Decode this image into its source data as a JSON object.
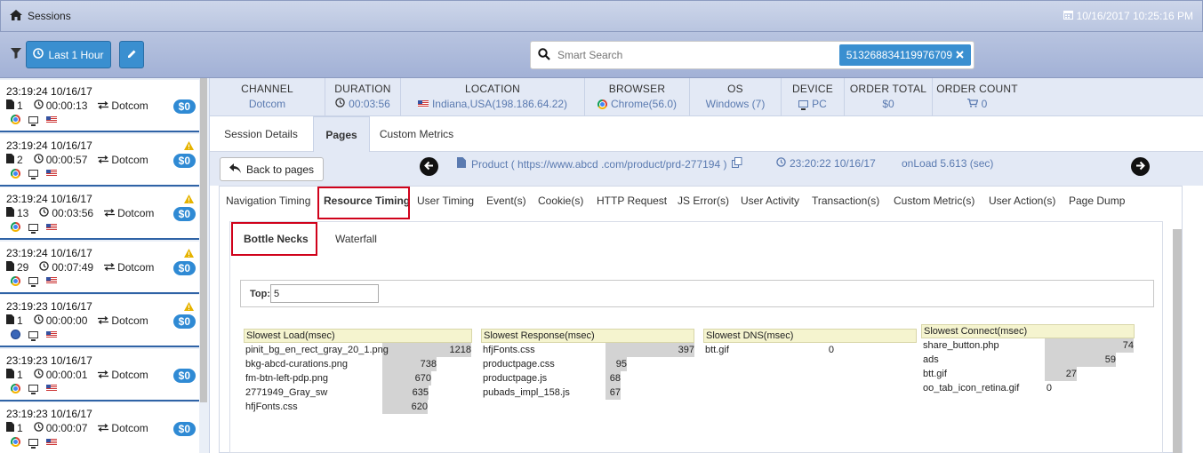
{
  "titlebar": {
    "title": "Sessions",
    "datetime": "10/16/2017 10:25:16 PM"
  },
  "toolbar": {
    "time_filter_label": "Last 1 Hour",
    "search_placeholder": "Smart Search",
    "search_tag": "513268834119976709"
  },
  "sessions": [
    {
      "time": "23:19:24 10/16/17",
      "pages": "1",
      "duration": "00:00:13",
      "channel": "Dotcom",
      "amount": "$0",
      "warning": false,
      "browser": "chrome"
    },
    {
      "time": "23:19:24 10/16/17",
      "pages": "2",
      "duration": "00:00:57",
      "channel": "Dotcom",
      "amount": "$0",
      "warning": true,
      "browser": "chrome"
    },
    {
      "time": "23:19:24 10/16/17",
      "pages": "13",
      "duration": "00:03:56",
      "channel": "Dotcom",
      "amount": "$0",
      "warning": true,
      "browser": "chrome"
    },
    {
      "time": "23:19:24 10/16/17",
      "pages": "29",
      "duration": "00:07:49",
      "channel": "Dotcom",
      "amount": "$0",
      "warning": true,
      "browser": "chrome"
    },
    {
      "time": "23:19:23 10/16/17",
      "pages": "1",
      "duration": "00:00:00",
      "channel": "Dotcom",
      "amount": "$0",
      "warning": true,
      "browser": "globe"
    },
    {
      "time": "23:19:23 10/16/17",
      "pages": "1",
      "duration": "00:00:01",
      "channel": "Dotcom",
      "amount": "$0",
      "warning": false,
      "browser": "chrome"
    },
    {
      "time": "23:19:23 10/16/17",
      "pages": "1",
      "duration": "00:00:07",
      "channel": "Dotcom",
      "amount": "$0",
      "warning": false,
      "browser": "chrome"
    }
  ],
  "summary": {
    "channel": {
      "label": "CHANNEL",
      "value": "Dotcom"
    },
    "duration": {
      "label": "DURATION",
      "value": "00:03:56"
    },
    "location": {
      "label": "LOCATION",
      "value": "Indiana,USA(198.186.64.22)"
    },
    "browser": {
      "label": "BROWSER",
      "value": "Chrome(56.0)"
    },
    "os": {
      "label": "OS",
      "value": "Windows (7)"
    },
    "device": {
      "label": "DEVICE",
      "value": "PC"
    },
    "order_total": {
      "label": "ORDER TOTAL",
      "value": "$0"
    },
    "order_count": {
      "label": "ORDER COUNT",
      "value": "0"
    }
  },
  "main_tabs": [
    "Session Details",
    "Pages",
    "Custom Metrics"
  ],
  "page_bar": {
    "back_label": "Back to pages",
    "page": "Product ( https://www.abcd .com/product/prd-277194 )",
    "time": "23:20:22 10/16/17",
    "onload": "onLoad 5.613 (sec)"
  },
  "detail_tabs": [
    "Navigation Timing",
    "Resource Timing",
    "User Timing",
    "Event(s)",
    "Cookie(s)",
    "HTTP Request",
    "JS Error(s)",
    "User Activity",
    "Transaction(s)",
    "Custom Metric(s)",
    "User Action(s)",
    "Page Dump"
  ],
  "resource_tabs": [
    "Bottle Necks",
    "Waterfall"
  ],
  "top": {
    "label": "Top:",
    "value": "5"
  },
  "tables": [
    {
      "title": "Slowest Load(msec)",
      "max": 1218,
      "rows": [
        {
          "name": "pinit_bg_en_rect_gray_20_1.png",
          "value": 1218
        },
        {
          "name": "bkg-abcd-curations.png",
          "value": 738
        },
        {
          "name": "fm-btn-left-pdp.png",
          "value": 670
        },
        {
          "name": "2771949_Gray_sw",
          "value": 635
        },
        {
          "name": "hfjFonts.css",
          "value": 620
        }
      ]
    },
    {
      "title": "Slowest Response(msec)",
      "max": 397,
      "rows": [
        {
          "name": "hfjFonts.css",
          "value": 397
        },
        {
          "name": "productpage.css",
          "value": 95
        },
        {
          "name": "productpage.js",
          "value": 68
        },
        {
          "name": "pubads_impl_158.js",
          "value": 67
        }
      ]
    },
    {
      "title": "Slowest DNS(msec)",
      "max": 0,
      "rows": [
        {
          "name": "btt.gif",
          "value": 0
        }
      ]
    },
    {
      "title": "Slowest Connect(msec)",
      "max": 74,
      "rows": [
        {
          "name": "share_button.php",
          "value": 74
        },
        {
          "name": "ads",
          "value": 59
        },
        {
          "name": "btt.gif",
          "value": 27
        },
        {
          "name": "oo_tab_icon_retina.gif",
          "value": 0
        }
      ]
    }
  ]
}
